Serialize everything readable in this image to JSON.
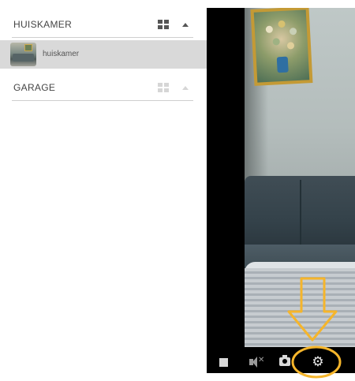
{
  "groups": [
    {
      "title": "HUISKAMER",
      "cameras": [
        {
          "label": "huiskamer"
        }
      ]
    },
    {
      "title": "GARAGE",
      "cameras": []
    }
  ],
  "player": {
    "controls": {
      "stop": "stop-icon",
      "mute": "mute-icon",
      "snapshot": "camera-icon",
      "settings": "gear-icon"
    }
  },
  "annotation": {
    "color": "#f5b52b",
    "highlighted_control": "settings"
  }
}
